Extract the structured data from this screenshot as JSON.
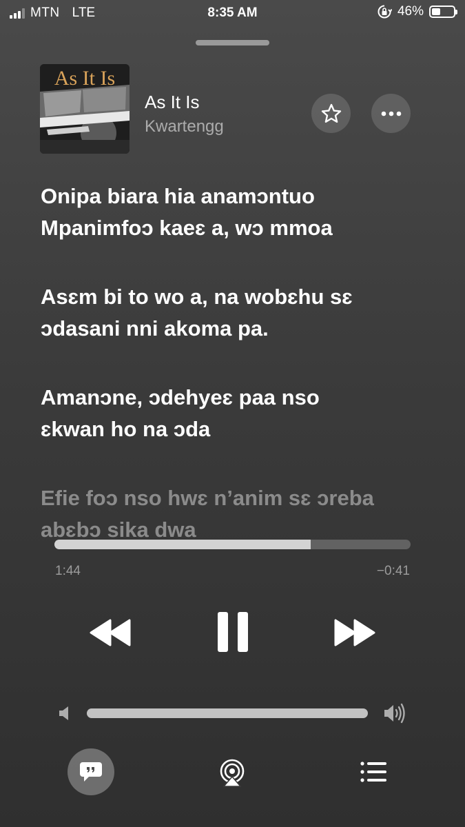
{
  "status_bar": {
    "carrier": "MTN",
    "network": "LTE",
    "time": "8:35 AM",
    "battery_percent": "46%",
    "battery_level": 0.46,
    "signal_bars_active": 3
  },
  "now_playing": {
    "album_art_text": "As It Is",
    "title": "As It Is",
    "artist": "Kwartengg",
    "favorite_icon": "star-icon",
    "more_icon": "ellipsis-icon"
  },
  "lyrics": [
    {
      "lines": [
        "Onipa biara hia anamɔntuo",
        "Mpanimfoɔ kaeɛ a, wɔ mmoa"
      ],
      "faded": false
    },
    {
      "lines": [
        "Asɛm bi to wo a, na wobɛhu sɛ",
        "ɔdasani nni akoma pa."
      ],
      "faded": false
    },
    {
      "lines": [
        "Amanɔne, ɔdehyeɛ paa nso",
        "ɛkwan ho na ɔda"
      ],
      "faded": false
    },
    {
      "lines": [
        "Efie foɔ nso hwɛ n’anim sɛ ɔreba",
        "abɛbɔ sika dwa"
      ],
      "faded": true
    }
  ],
  "playback": {
    "elapsed": "1:44",
    "remaining": "−0:41",
    "progress": 0.72,
    "volume": 1.0
  },
  "controls": {
    "previous_icon": "rewind-icon",
    "pause_icon": "pause-icon",
    "next_icon": "fast-forward-icon",
    "volume_low_icon": "speaker-low-icon",
    "volume_high_icon": "speaker-high-icon",
    "lyrics_icon": "quote-bubble-icon",
    "airplay_icon": "airplay-icon",
    "queue_icon": "list-icon"
  },
  "colors": {
    "background_top": "#4a4a4a",
    "background_bottom": "#2f2f2f",
    "album_text": "#d9a35a"
  }
}
